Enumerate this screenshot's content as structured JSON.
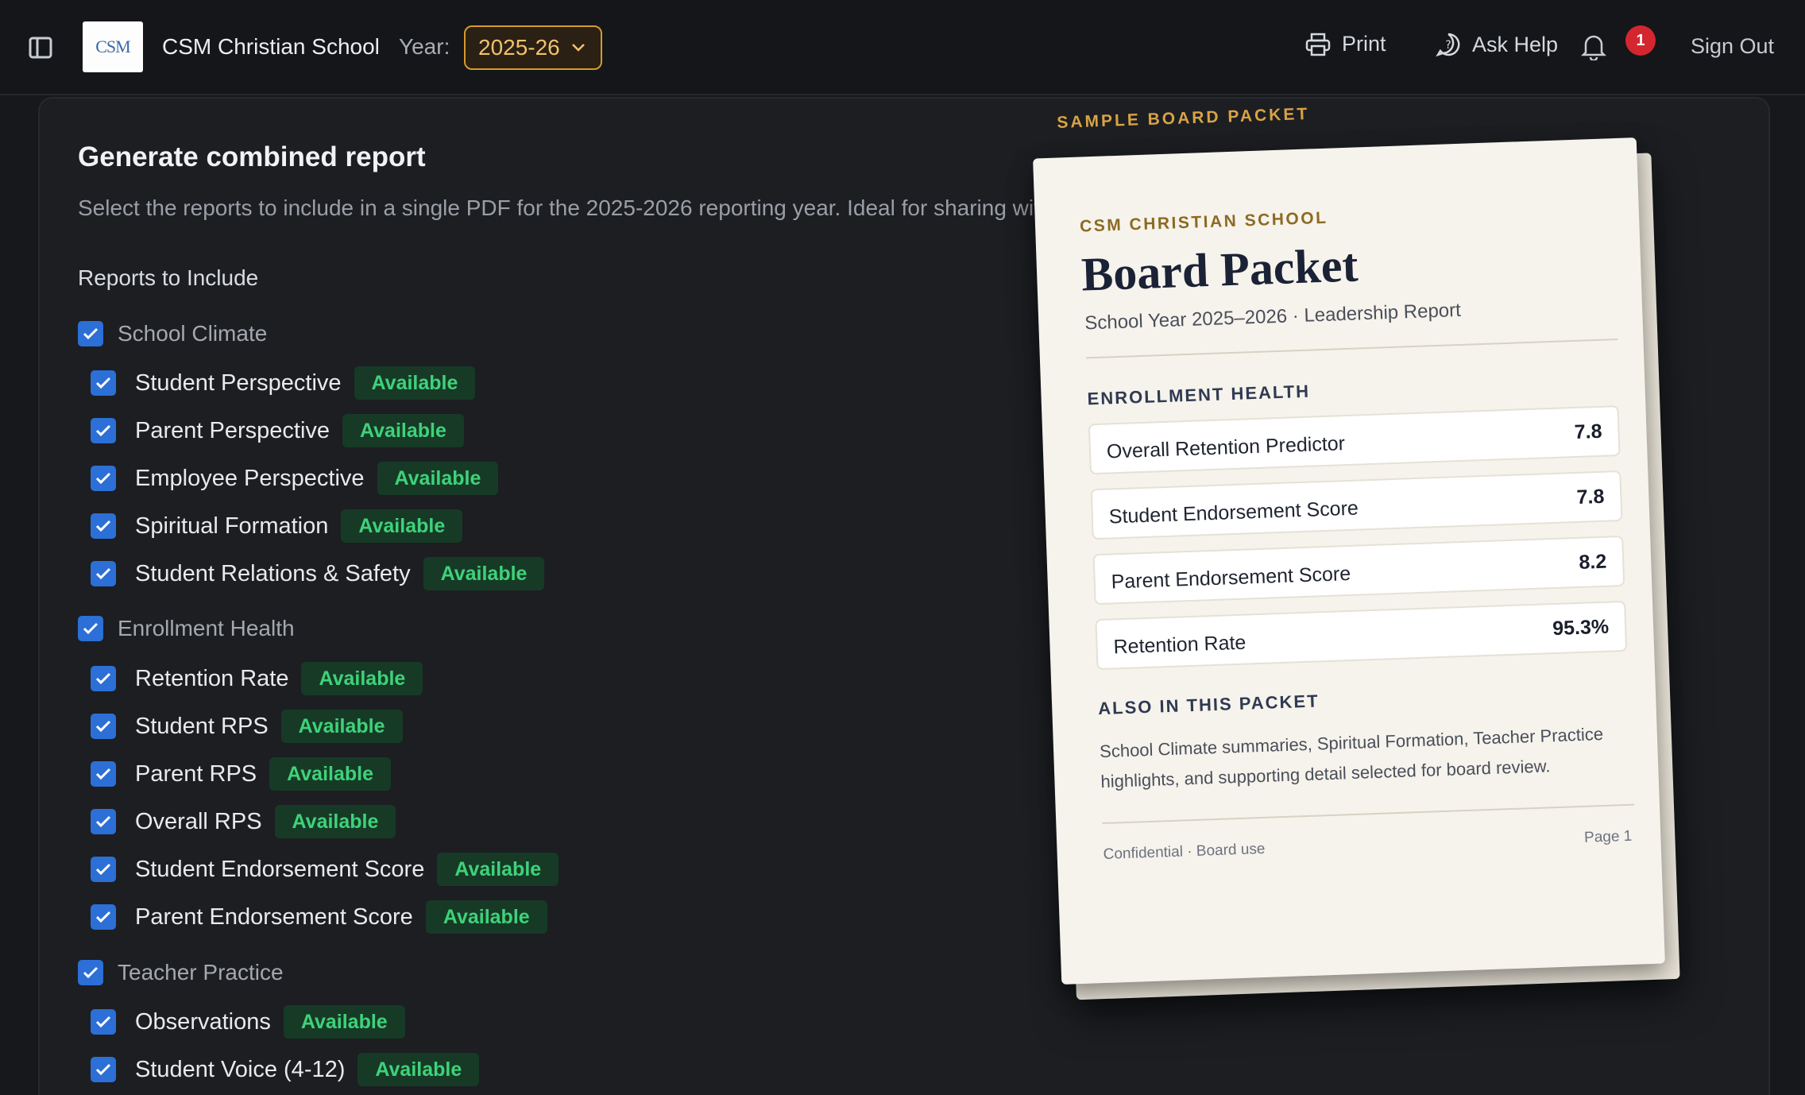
{
  "header": {
    "school_name": "CSM Christian School",
    "logo_text": "CSM",
    "year_label": "Year:",
    "year_value": "2025-26",
    "print_label": "Print",
    "help_label": "Ask Help",
    "notification_count": "1",
    "signout_label": "Sign Out"
  },
  "main": {
    "title": "Generate combined report",
    "subtitle": "Select the reports to include in a single PDF for the 2025-2026 reporting year. Ideal for sharing with",
    "section_label": "Reports to Include",
    "groups": [
      {
        "label": "School Climate",
        "items": [
          {
            "label": "Student Perspective",
            "status": "Available"
          },
          {
            "label": "Parent Perspective",
            "status": "Available"
          },
          {
            "label": "Employee Perspective",
            "status": "Available"
          },
          {
            "label": "Spiritual Formation",
            "status": "Available"
          },
          {
            "label": "Student Relations & Safety",
            "status": "Available"
          }
        ]
      },
      {
        "label": "Enrollment Health",
        "items": [
          {
            "label": "Retention Rate",
            "status": "Available"
          },
          {
            "label": "Student RPS",
            "status": "Available"
          },
          {
            "label": "Parent RPS",
            "status": "Available"
          },
          {
            "label": "Overall RPS",
            "status": "Available"
          },
          {
            "label": "Student Endorsement Score",
            "status": "Available"
          },
          {
            "label": "Parent Endorsement Score",
            "status": "Available"
          }
        ]
      },
      {
        "label": "Teacher Practice",
        "items": [
          {
            "label": "Observations",
            "status": "Available"
          },
          {
            "label": "Student Voice (4-12)",
            "status": "Available"
          }
        ]
      }
    ]
  },
  "packet": {
    "eyebrow": "SAMPLE BOARD PACKET",
    "school": "CSM CHRISTIAN SCHOOL",
    "title": "Board Packet",
    "subtitle": "School Year 2025–2026 · Leadership Report",
    "metrics_heading": "ENROLLMENT HEALTH",
    "metrics": [
      {
        "label": "Overall Retention Predictor",
        "value": "7.8"
      },
      {
        "label": "Student Endorsement Score",
        "value": "7.8"
      },
      {
        "label": "Parent Endorsement Score",
        "value": "8.2"
      },
      {
        "label": "Retention Rate",
        "value": "95.3%"
      }
    ],
    "also_heading": "ALSO IN THIS PACKET",
    "also_body": "School Climate summaries, Spiritual Formation, Teacher Practice highlights, and supporting detail selected for board review.",
    "footer_left": "Confidential · Board use",
    "footer_right": "Page 1"
  },
  "colors": {
    "accent": "#2c6fd6",
    "available_text": "#3ed27a",
    "available_bg": "#173a26",
    "year_border": "#d69a2c",
    "badge": "#d4262e"
  }
}
